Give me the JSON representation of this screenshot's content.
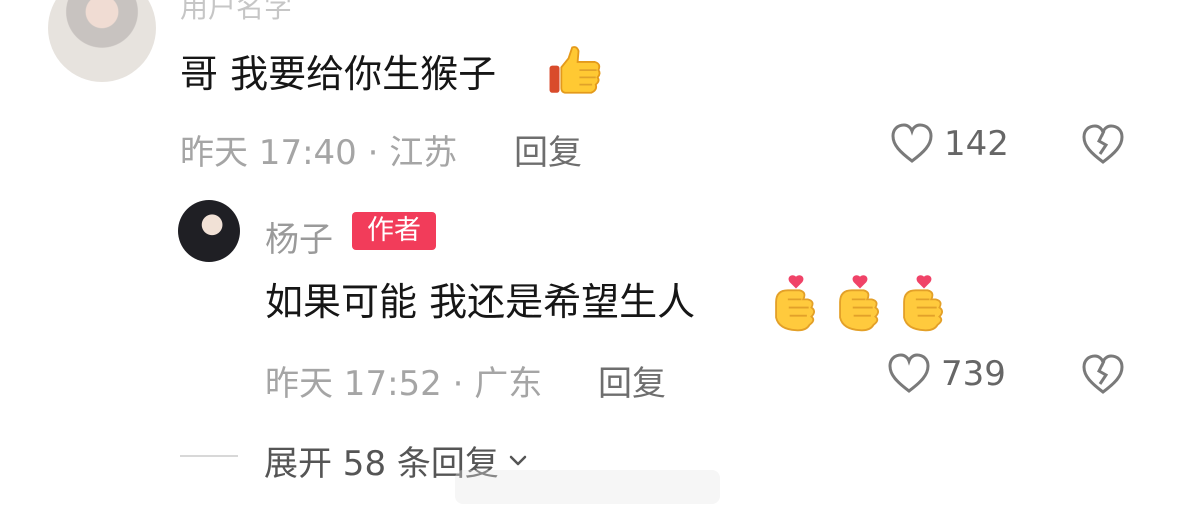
{
  "cut_username": "用户名字",
  "comment": {
    "text": "哥 我要给你生猴子",
    "emoji": "thumbs-up-emoji",
    "time_location": "昨天 17:40 · 江苏",
    "reply_label": "回复",
    "likes": "142"
  },
  "reply": {
    "username": "杨子",
    "badge": "作者",
    "text": "如果可能 我还是希望生人",
    "emoji": [
      "finger-heart-emoji",
      "finger-heart-emoji",
      "finger-heart-emoji"
    ],
    "time_location": "昨天 17:52 · 广东",
    "reply_label": "回复",
    "likes": "739"
  },
  "expand": {
    "label": "展开 58 条回复"
  },
  "colors": {
    "badge": "#f23c5a",
    "meta": "#a5a5a5",
    "text": "#161616"
  }
}
